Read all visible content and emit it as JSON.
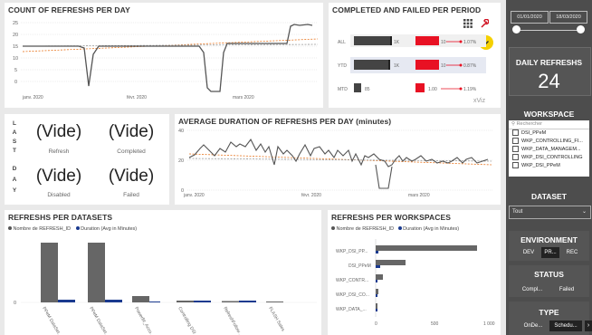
{
  "refresh_per_day": {
    "title": "COUNT OF REFRESHS PER DAY",
    "yticks": [
      "25",
      "20",
      "15",
      "10",
      "5",
      "0"
    ],
    "xticks": [
      "janv. 2020",
      "févr. 2020",
      "mars 2020"
    ]
  },
  "completed_failed": {
    "title": "COMPLETED AND FAILED PER PERIOD",
    "rows": [
      {
        "label": "ALL",
        "count": "1K",
        "fail_label": "10",
        "pct": "1.07%"
      },
      {
        "label": "YTD",
        "count": "1K",
        "fail_label": "10",
        "pct": "0.87%"
      },
      {
        "label": "MTD",
        "count": "85",
        "fail_label": "1.00",
        "pct": "1.19%"
      }
    ],
    "brand": "xViz"
  },
  "last_day": {
    "vertical_a": [
      "L",
      "A",
      "S",
      "T"
    ],
    "vertical_b": [
      "D",
      "A",
      "Y"
    ],
    "cells": [
      {
        "value": "(Vide)",
        "caption": "Refresh"
      },
      {
        "value": "(Vide)",
        "caption": "Completed"
      },
      {
        "value": "(Vide)",
        "caption": "Disabled"
      },
      {
        "value": "(Vide)",
        "caption": "Failed"
      }
    ]
  },
  "avg_duration": {
    "title": "AVERAGE DURATION OF REFRESHS PER DAY (minutes)",
    "yticks": [
      "40",
      "20",
      "0"
    ],
    "xticks": [
      "janv. 2020",
      "févr. 2020",
      "mars 2020"
    ]
  },
  "per_datasets": {
    "title": "REFRESHS PER DATASETS",
    "legend": [
      "Nombre de REFRESH_ID",
      "Duration (Avg in Minutes)"
    ],
    "ytick_zero": "0",
    "categories": [
      "PPeM DataSet...",
      "PPeM DataSet...",
      "PowerBI_Acco...",
      "Controlling DSI",
      "RefreshFollow...",
      "FLASH Sales"
    ]
  },
  "per_workspaces": {
    "title": "REFRESHS PER WORKSPACES",
    "legend": [
      "Nombre de REFRESH_ID",
      "Duration (Avg in Minutes)"
    ],
    "categories": [
      "WKP_DSI_PP...",
      "DSI_PPeM",
      "WKP_CONTR...",
      "WKP_DSI_CO...",
      "WKP_DATA_..."
    ],
    "xticks": [
      "0",
      "500",
      "1 000"
    ]
  },
  "sidebar": {
    "date_from": "01/01/2020",
    "date_to": "18/03/2020",
    "daily_label": "DAILY REFRESHS",
    "daily_value": "24",
    "workspace_label": "WORKSPACE",
    "search_placeholder": "Rechercher",
    "workspaces": [
      "DSI_PPeM",
      "WKP_CONTROLLING_FI...",
      "WKP_DATA_MANAGEM...",
      "WKP_DSI_CONTROLLING",
      "WKP_DSI_PPeM"
    ],
    "dataset_label": "DATASET",
    "dataset_value": "Tout",
    "environment_label": "ENVIRONMENT",
    "env_buttons": [
      "DEV",
      "PR...",
      "REC"
    ],
    "status_label": "STATUS",
    "status_buttons": [
      "Compl...",
      "Failed"
    ],
    "type_label": "TYPE",
    "type_buttons": [
      "OnDe...",
      "Schedu..."
    ]
  },
  "colors": {
    "accent": "#f5d000",
    "dark": "#555555",
    "red": "#e81123",
    "blue": "#1a3a8f",
    "orange": "#e87722"
  }
}
